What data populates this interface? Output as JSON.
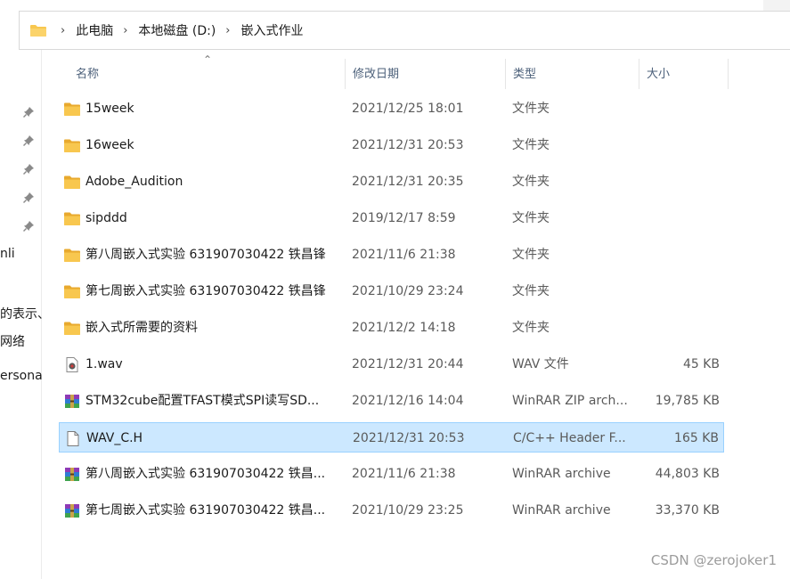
{
  "breadcrumb": [
    "此电脑",
    "本地磁盘 (D:)",
    "嵌入式作业"
  ],
  "columns": {
    "name": "名称",
    "date": "修改日期",
    "type": "类型",
    "size": "大小"
  },
  "nav_partial_labels": [
    "nli",
    "的表示、",
    "网络",
    "ersona"
  ],
  "files": [
    {
      "name": "15week",
      "date": "2021/12/25 18:01",
      "type": "文件夹",
      "size": "",
      "icon": "folder-icon"
    },
    {
      "name": "16week",
      "date": "2021/12/31 20:53",
      "type": "文件夹",
      "size": "",
      "icon": "folder-icon"
    },
    {
      "name": "Adobe_Audition",
      "date": "2021/12/31 20:35",
      "type": "文件夹",
      "size": "",
      "icon": "folder-icon"
    },
    {
      "name": "sipddd",
      "date": "2019/12/17 8:59",
      "type": "文件夹",
      "size": "",
      "icon": "folder-icon"
    },
    {
      "name": "第八周嵌入式实验 631907030422 铁昌锋",
      "date": "2021/11/6 21:38",
      "type": "文件夹",
      "size": "",
      "icon": "folder-icon"
    },
    {
      "name": "第七周嵌入式实验 631907030422 铁昌锋",
      "date": "2021/10/29 23:24",
      "type": "文件夹",
      "size": "",
      "icon": "folder-icon"
    },
    {
      "name": "嵌入式所需要的资料",
      "date": "2021/12/2 14:18",
      "type": "文件夹",
      "size": "",
      "icon": "folder-icon"
    },
    {
      "name": "1.wav",
      "date": "2021/12/31 20:44",
      "type": "WAV 文件",
      "size": "45 KB",
      "icon": "audio-file-icon"
    },
    {
      "name": "STM32cube配置TFAST模式SPI读写SD...",
      "date": "2021/12/16 14:04",
      "type": "WinRAR ZIP arch...",
      "size": "19,785 KB",
      "icon": "winrar-icon"
    },
    {
      "name": "WAV_C.H",
      "date": "2021/12/31 20:53",
      "type": "C/C++ Header F...",
      "size": "165 KB",
      "icon": "document-icon",
      "selected": true
    },
    {
      "name": "第八周嵌入式实验 631907030422 铁昌...",
      "date": "2021/11/6 21:38",
      "type": "WinRAR archive",
      "size": "44,803 KB",
      "icon": "winrar-icon"
    },
    {
      "name": "第七周嵌入式实验 631907030422 铁昌...",
      "date": "2021/10/29 23:25",
      "type": "WinRAR archive",
      "size": "33,370 KB",
      "icon": "winrar-icon"
    }
  ],
  "watermark": "CSDN @zerojoker1",
  "colors": {
    "folder": "#f8c74f",
    "selection_bg": "#cce8ff",
    "selection_border": "#99d1ff",
    "header_text": "#4c607a"
  }
}
